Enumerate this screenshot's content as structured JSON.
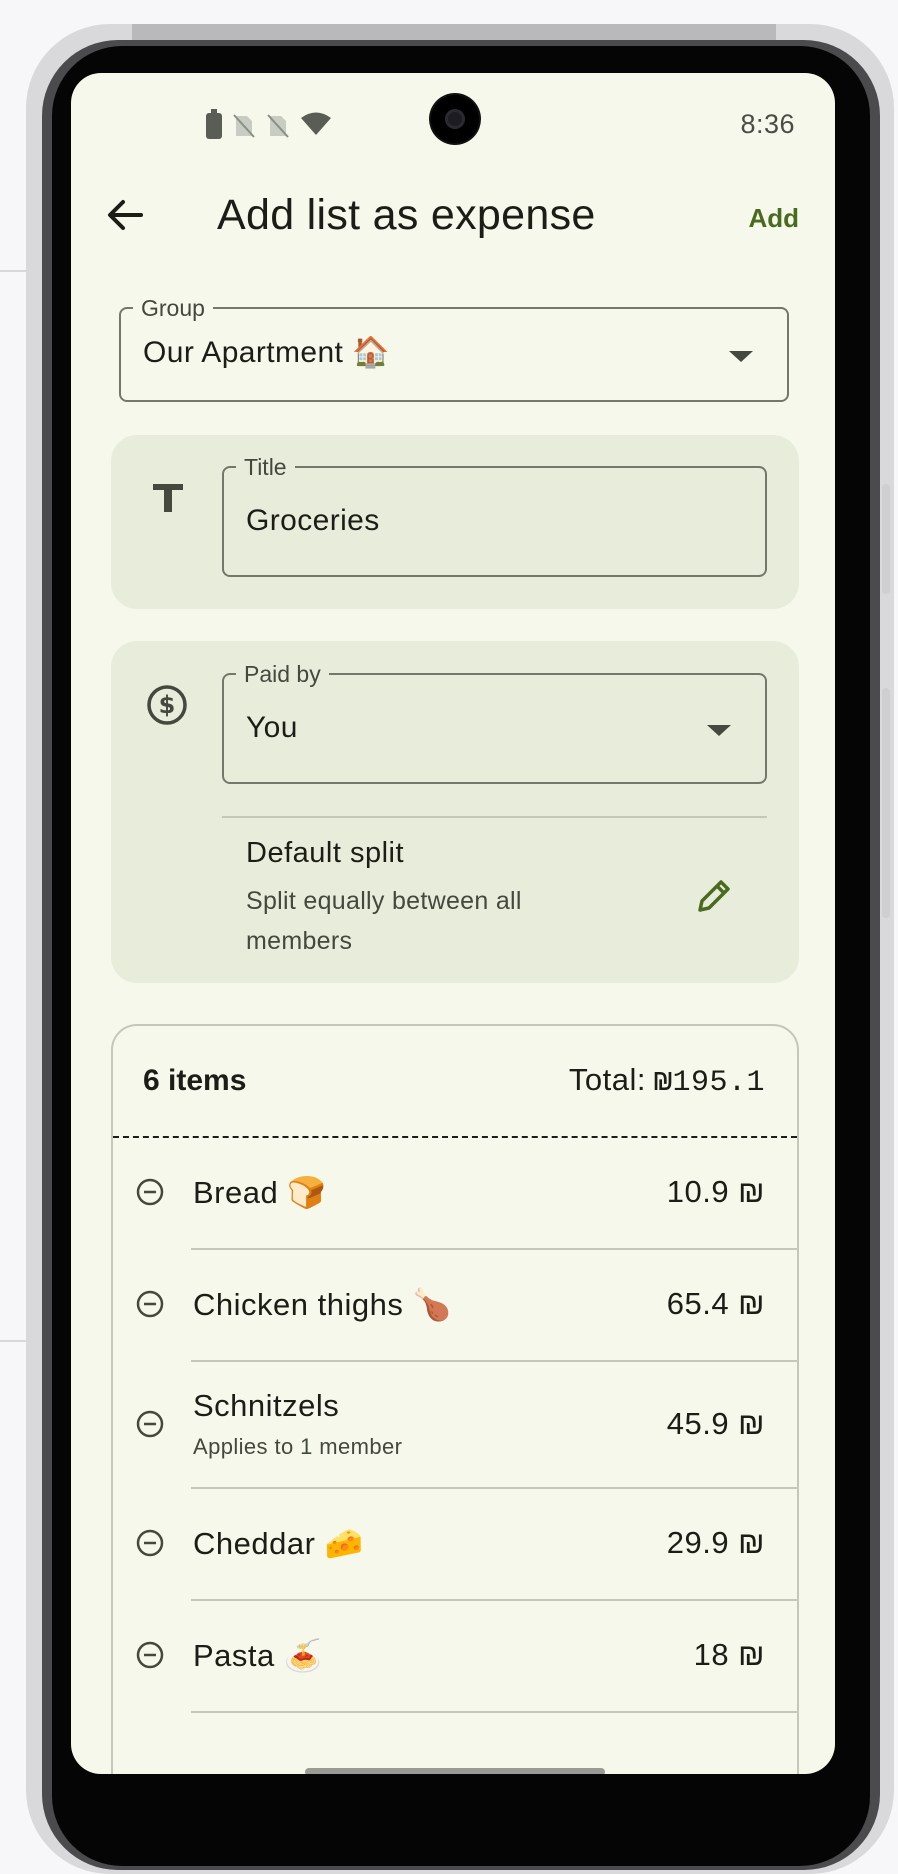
{
  "status_bar": {
    "time": "8:36"
  },
  "app_bar": {
    "title": "Add list as expense",
    "action_label": "Add"
  },
  "group_field": {
    "label": "Group",
    "value": "Our Apartment 🏠"
  },
  "title_field": {
    "label": "Title",
    "value": "Groceries"
  },
  "paid_by_field": {
    "label": "Paid by",
    "value": "You"
  },
  "split": {
    "title": "Default split",
    "description": "Split equally between all members"
  },
  "items_summary": {
    "count_text": "6 items",
    "total_label": "Total:",
    "total_value": "₪195.1"
  },
  "items": [
    {
      "name": "Bread 🍞",
      "subtitle": "",
      "price": "10.9 ₪"
    },
    {
      "name": "Chicken thighs 🍗",
      "subtitle": "",
      "price": "65.4 ₪"
    },
    {
      "name": "Schnitzels",
      "subtitle": "Applies to 1 member",
      "price": "45.9 ₪"
    },
    {
      "name": "Cheddar 🧀",
      "subtitle": "",
      "price": "29.9 ₪"
    },
    {
      "name": "Pasta 🍝",
      "subtitle": "",
      "price": "18 ₪"
    }
  ],
  "colors": {
    "background": "#f5f8ea",
    "card_tonal": "#e8eddb",
    "accent": "#4a6b1f",
    "text": "#1b1d16",
    "outline": "#74786b"
  },
  "icons": {
    "back": "arrow-left-icon",
    "title_field": "text-t-icon",
    "paid_by": "dollar-circle-icon",
    "edit_split": "pencil-icon",
    "remove_item": "minus-circle-icon",
    "dropdown": "caret-down-icon"
  }
}
